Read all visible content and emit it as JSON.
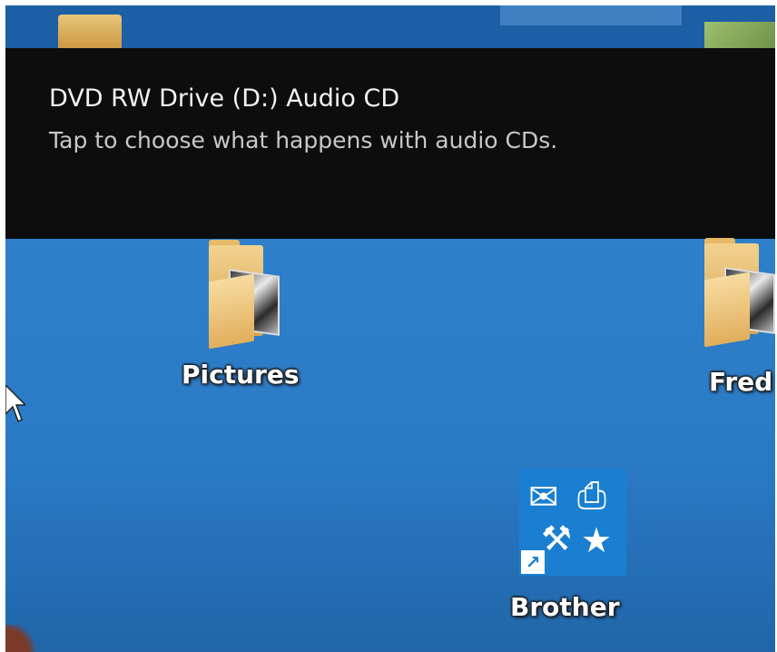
{
  "notification": {
    "title": "DVD RW Drive (D:) Audio CD",
    "message": "Tap to choose what happens with audio CDs."
  },
  "desktop": {
    "icons": [
      {
        "label": "Pictures",
        "icon": "folder-icon"
      },
      {
        "label": "Fred",
        "icon": "folder-icon"
      },
      {
        "label": "Brother",
        "icon": "brother-utilities-icon"
      }
    ]
  },
  "colors": {
    "desktop_background": "#2f7fca",
    "toast_background": "#0d0d0d",
    "brother_tile": "#1a7fd1"
  }
}
